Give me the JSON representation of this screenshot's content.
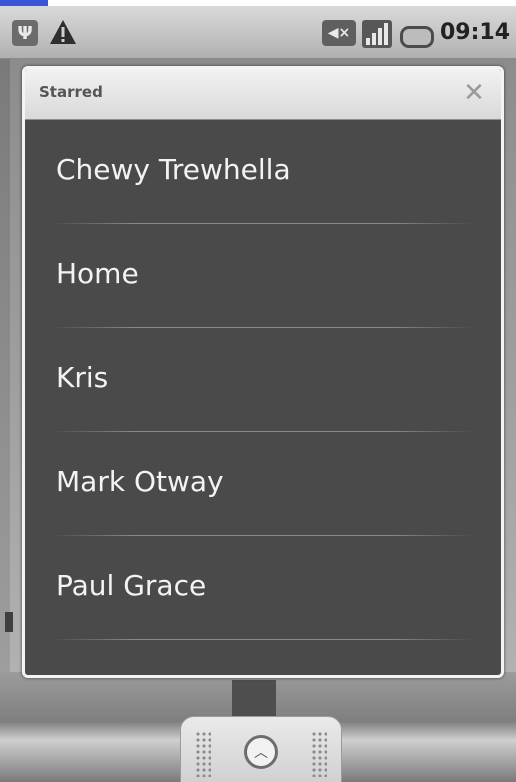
{
  "status_bar": {
    "time": "09:14",
    "icons": [
      "usb-icon",
      "warning-icon",
      "mute-icon",
      "signal-icon",
      "battery-icon"
    ]
  },
  "dialog": {
    "title": "Starred",
    "close_label": "✕",
    "items": [
      {
        "label": "Chewy Trewhella"
      },
      {
        "label": "Home"
      },
      {
        "label": "Kris"
      },
      {
        "label": "Mark Otway"
      },
      {
        "label": "Paul Grace"
      }
    ]
  },
  "launcher": {
    "icon": "launcher-up-icon"
  },
  "colors": {
    "dialog_bg": "#4a4a4a",
    "titlebar_bg": "#e6e6e6",
    "item_text": "#f3f3f3"
  }
}
